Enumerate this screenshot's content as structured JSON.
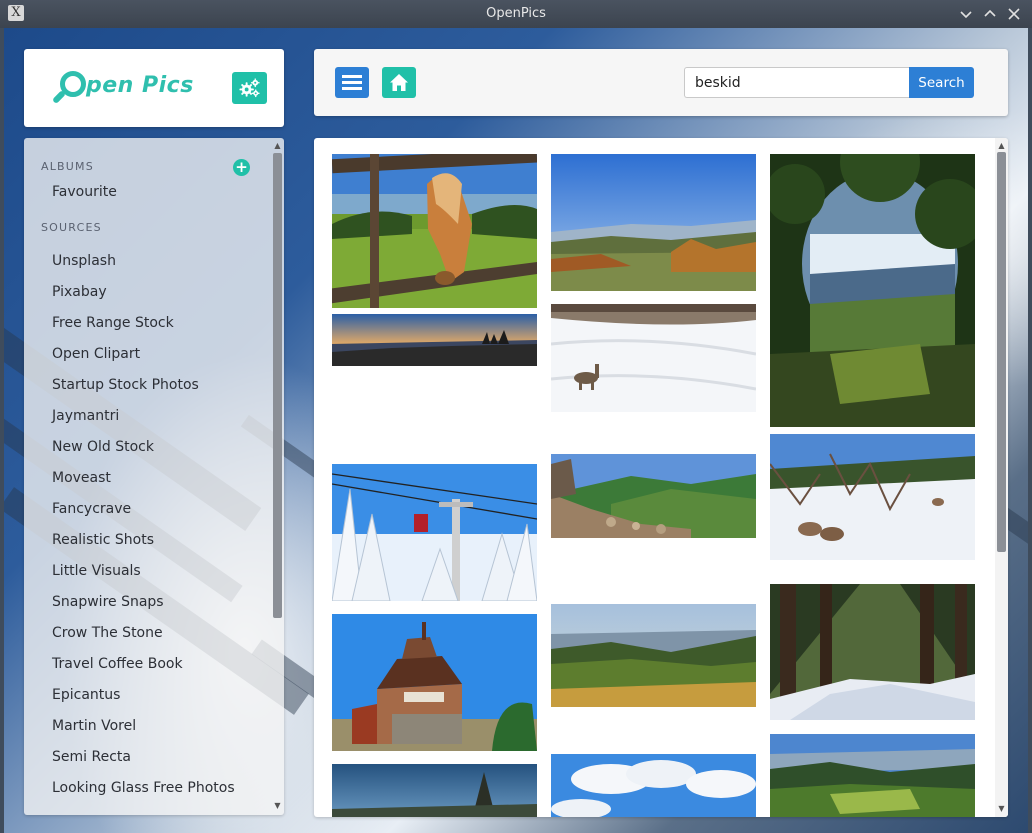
{
  "window": {
    "title": "OpenPics",
    "app_icon": "X"
  },
  "logo": {
    "text": "pen Pics",
    "letter": "O"
  },
  "search": {
    "value": "beskid",
    "button_label": "Search"
  },
  "sidebar": {
    "albums_title": "ALBUMS",
    "albums": [
      {
        "label": "Favourite"
      }
    ],
    "sources_title": "SOURCES",
    "sources": [
      {
        "label": "Unsplash"
      },
      {
        "label": "Pixabay"
      },
      {
        "label": "Free Range Stock"
      },
      {
        "label": "Open Clipart"
      },
      {
        "label": "Startup Stock Photos"
      },
      {
        "label": "Jaymantri"
      },
      {
        "label": "New Old Stock"
      },
      {
        "label": "Moveast"
      },
      {
        "label": "Fancycrave"
      },
      {
        "label": "Realistic Shots"
      },
      {
        "label": "Little Visuals"
      },
      {
        "label": "Snapwire Snaps"
      },
      {
        "label": "Crow The Stone"
      },
      {
        "label": "Travel Coffee Book"
      },
      {
        "label": "Epicantus"
      },
      {
        "label": "Martin Vorel"
      },
      {
        "label": "Semi Recta"
      },
      {
        "label": "Looking Glass Free Photos"
      }
    ]
  },
  "colors": {
    "accent_teal": "#20c0a8",
    "accent_blue": "#2d7fd5"
  },
  "icons": {
    "settings": "gears-icon",
    "menu": "hamburger-icon",
    "home": "home-icon",
    "add_album": "plus-circle-icon"
  }
}
